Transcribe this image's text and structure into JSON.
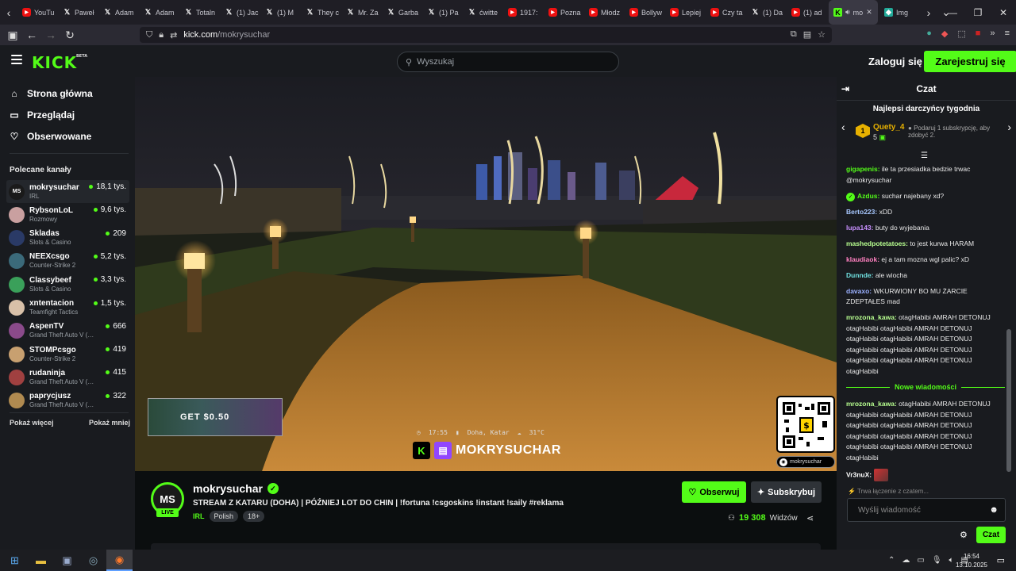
{
  "browser": {
    "tabs": [
      {
        "icon": "youtube-icon",
        "label": "YouTu"
      },
      {
        "icon": "x-icon",
        "label": "Paweł"
      },
      {
        "icon": "x-icon",
        "label": "Adam"
      },
      {
        "icon": "x-icon",
        "label": "Adam"
      },
      {
        "icon": "x-icon",
        "label": "Totaln"
      },
      {
        "icon": "x-icon",
        "label": "(1) Jac"
      },
      {
        "icon": "x-icon",
        "label": "(1) M"
      },
      {
        "icon": "x-icon",
        "label": "They c"
      },
      {
        "icon": "x-icon",
        "label": "Mr. Za"
      },
      {
        "icon": "x-icon",
        "label": "Garba"
      },
      {
        "icon": "x-icon",
        "label": "(1) Pa"
      },
      {
        "icon": "x-icon",
        "label": "ćwitte"
      },
      {
        "icon": "youtube-icon",
        "label": "1917:"
      },
      {
        "icon": "youtube-icon",
        "label": "Pozna"
      },
      {
        "icon": "youtube-icon",
        "label": "Młodz"
      },
      {
        "icon": "youtube-icon",
        "label": "Bollyw"
      },
      {
        "icon": "youtube-icon",
        "label": "Lepiej"
      },
      {
        "icon": "youtube-icon",
        "label": "Czy ta"
      },
      {
        "icon": "x-icon",
        "label": "(1) Da"
      },
      {
        "icon": "youtube-icon",
        "label": "(1) ad"
      }
    ],
    "active_tab": {
      "label": "mo"
    },
    "extra_tab": {
      "label": "Img"
    },
    "url_host": "kick.com",
    "url_path": "/mokrysuchar"
  },
  "header": {
    "logo": "KICK",
    "logo_badge": "BETA",
    "search_placeholder": "Wyszukaj",
    "login": "Zaloguj się",
    "register": "Zarejestruj się"
  },
  "sidebar": {
    "nav": [
      {
        "label": "Strona główna",
        "icon": "home-icon"
      },
      {
        "label": "Przeglądaj",
        "icon": "browse-icon"
      },
      {
        "label": "Obserwowane",
        "icon": "heart-icon"
      }
    ],
    "recommended_title": "Polecane kanały",
    "channels": [
      {
        "name": "mokrysuchar",
        "category": "IRL",
        "viewers": "18,1 tys.",
        "avatar": "MS",
        "color": "#1a1a1a"
      },
      {
        "name": "RybsonLoL",
        "category": "Rozmowy",
        "viewers": "9,6 tys.",
        "avatar": "",
        "color": "#c9a0a0"
      },
      {
        "name": "Skladas",
        "category": "Slots & Casino",
        "viewers": "209",
        "avatar": "",
        "color": "#2a3a66"
      },
      {
        "name": "NEEXcsgo",
        "category": "Counter-Strike 2",
        "viewers": "5,2 tys.",
        "avatar": "",
        "color": "#3b6a7a"
      },
      {
        "name": "Classybeef",
        "category": "Slots & Casino",
        "viewers": "3,3 tys.",
        "avatar": "",
        "color": "#3aa05a"
      },
      {
        "name": "xntentacion",
        "category": "Teamfight Tactics",
        "viewers": "1,5 tys.",
        "avatar": "",
        "color": "#d8c0a8"
      },
      {
        "name": "AspenTV",
        "category": "Grand Theft Auto V (G...",
        "viewers": "666",
        "avatar": "",
        "color": "#8a4a8a"
      },
      {
        "name": "STOMPcsgo",
        "category": "Counter-Strike 2",
        "viewers": "419",
        "avatar": "",
        "color": "#c8a070"
      },
      {
        "name": "rudaninja",
        "category": "Grand Theft Auto V (G...",
        "viewers": "415",
        "avatar": "",
        "color": "#a04040"
      },
      {
        "name": "paprycjusz",
        "category": "Grand Theft Auto V (G...",
        "viewers": "322",
        "avatar": "",
        "color": "#b08a50"
      }
    ],
    "show_more": "Pokaż więcej",
    "show_less": "Pokaż mniej"
  },
  "player": {
    "overlay_time": "17:55",
    "overlay_place": "Doha, Katar",
    "overlay_temp": "31°C",
    "overlay_name": "MOKRYSUCHAR",
    "qr_handle": "mokrysuchar",
    "ad_text": "GET $0.50"
  },
  "stream": {
    "avatar": "MS",
    "live": "LIVE",
    "streamer": "mokrysuchar",
    "title": "STREAM Z KATARU (DOHA) | PÓŹNIEJ LOT DO CHIN | !fortuna !csgoskins !instant !saily #reklama",
    "category": "IRL",
    "tags": [
      "Polish",
      "18+"
    ],
    "follow": "Obserwuj",
    "subscribe": "Subskrybuj",
    "viewers_count": "19 308",
    "viewers_label": "Widzów"
  },
  "chat": {
    "title": "Czat",
    "gifters_title": "Najlepsi darczyńcy tygodnia",
    "gifter_rank": "1",
    "gifter_name": "Quety_4",
    "gifter_count": "5",
    "gifter_cta": "Podaruj 1 subskrypcję, aby zdobyć 2.",
    "messages": [
      {
        "user": "gigapenis",
        "color": "#53fc18",
        "text": "ile ta przesiadka bedzie trwac @mokrysuchar"
      },
      {
        "user": "Azdus",
        "color": "#53fc18",
        "text": "suchar najebany xd?"
      },
      {
        "user": "Berto223",
        "color": "#a8c8ff",
        "text": "xDD"
      },
      {
        "user": "lupa143",
        "color": "#c890ff",
        "text": "buty do wyjebania"
      },
      {
        "user": "mashedpotetatoes",
        "color": "#b8ff90",
        "text": "to jest kurwa HARAM"
      },
      {
        "user": "klaudiaok",
        "color": "#ff80c0",
        "text": "ej a tam mozna wgl palic? xD"
      },
      {
        "user": "Dunnde",
        "color": "#70e0e0",
        "text": "ale wiocha"
      },
      {
        "user": "davaxo",
        "color": "#9ab0ff",
        "text": "WKURWIONY BO MU ŻARCIE ZDEPTAŁES mad"
      },
      {
        "user": "mrozona_kawa",
        "color": "#b8ff90",
        "text": "otagHabibi AMRAH DETONUJ otagHabibi otagHabibi AMRAH DETONUJ otagHabibi otagHabibi AMRAH DETONUJ otagHabibi otagHabibi AMRAH DETONUJ otagHabibi otagHabibi AMRAH DETONUJ otagHabibi"
      }
    ],
    "new_messages": "Nowe wiadomości",
    "messages_after": [
      {
        "user": "mrozona_kawa",
        "color": "#b8ff90",
        "text": "otagHabibi AMRAH DETONUJ otagHabibi otagHabibi AMRAH DETONUJ otagHabibi otagHabibi AMRAH DETONUJ otagHabibi otagHabibi AMRAH DETONUJ otagHabibi otagHabibi AMRAH DETONUJ otagHabibi"
      },
      {
        "user": "Vr3nuX",
        "color": "#ffffff",
        "text": ""
      }
    ],
    "connecting": "Trwa łączenie z czatem...",
    "input_placeholder": "Wyślij wiadomość",
    "send": "Czat"
  },
  "taskbar": {
    "time": "16:54",
    "date": "13.10.2025"
  }
}
